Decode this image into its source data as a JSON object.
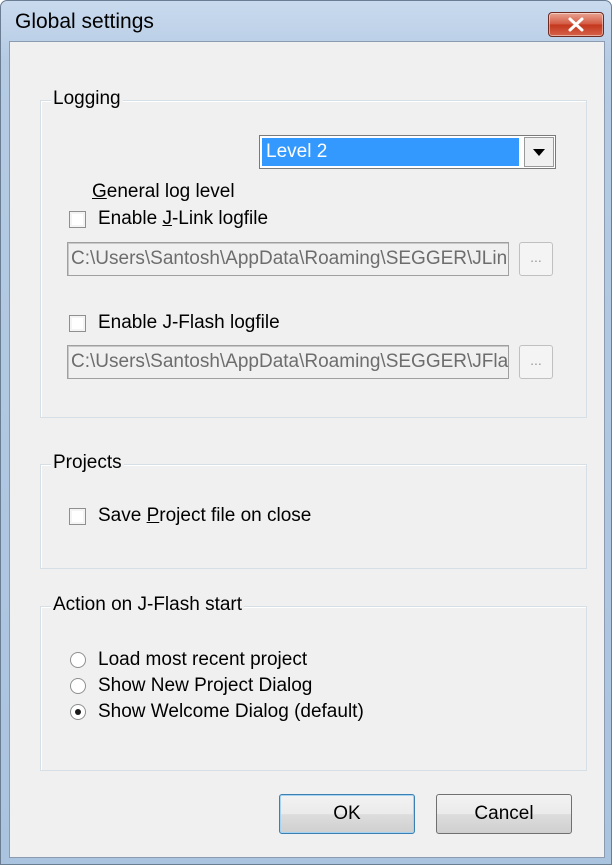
{
  "window": {
    "title": "Global settings",
    "close_symbol": "x"
  },
  "logging": {
    "group_label": "Logging",
    "log_level_label": "General log level",
    "log_level_value": "Level 2",
    "jlink_log": {
      "label": "Enable J-Link logfile",
      "checked": false,
      "path": "C:\\Users\\Santosh\\AppData\\Roaming\\SEGGER\\JLinkLog.txt",
      "browse_label": "..."
    },
    "jflash_log": {
      "label": "Enable J-Flash logfile",
      "checked": false,
      "path": "C:\\Users\\Santosh\\AppData\\Roaming\\SEGGER\\JFlashLog.txt",
      "browse_label": "..."
    }
  },
  "projects": {
    "group_label": "Projects",
    "save_on_close": {
      "label": "Save Project file on close",
      "checked": false
    }
  },
  "startup": {
    "group_label": "Action on J-Flash start",
    "options": [
      {
        "label": "Load most recent project",
        "checked": false
      },
      {
        "label": "Show New Project Dialog",
        "checked": false
      },
      {
        "label": "Show Welcome Dialog (default)",
        "checked": true
      }
    ]
  },
  "buttons": {
    "ok": "OK",
    "cancel": "Cancel"
  }
}
